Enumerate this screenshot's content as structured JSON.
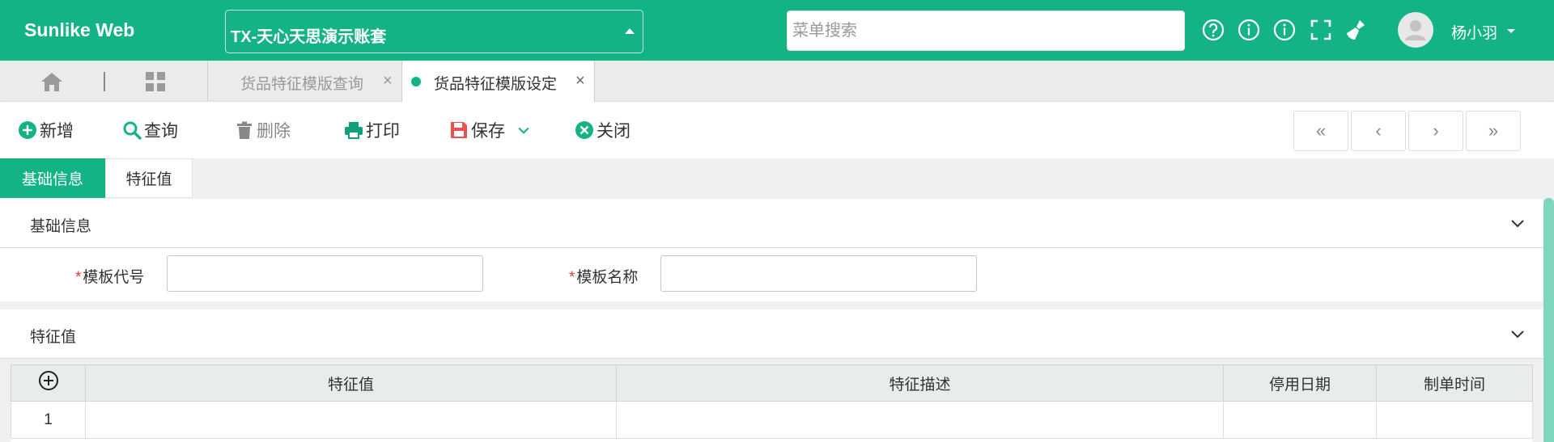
{
  "header": {
    "brand": "Sunlike Web",
    "account_name": "TX-天心天思演示账套",
    "menu_search_placeholder": "菜单搜索",
    "user_name": "杨小羽"
  },
  "tabs": [
    {
      "label": "货品特征模版查询",
      "active": false
    },
    {
      "label": "货品特征模版设定",
      "active": true
    }
  ],
  "toolbar": {
    "add": "新增",
    "query": "查询",
    "delete": "删除",
    "print": "打印",
    "save": "保存",
    "close": "关闭",
    "nav": [
      "«",
      "‹",
      "›",
      "»"
    ]
  },
  "subtabs": [
    "基础信息",
    "特征值"
  ],
  "basic_section": {
    "title": "基础信息",
    "fields": [
      {
        "label": "模板代号",
        "required": true,
        "value": ""
      },
      {
        "label": "模板名称",
        "required": true,
        "value": ""
      }
    ]
  },
  "feature_section": {
    "title": "特征值",
    "columns": [
      "特征值",
      "特征描述",
      "停用日期",
      "制单时间"
    ],
    "rows": [
      {
        "index": "1",
        "cells": [
          "",
          "",
          "",
          ""
        ]
      }
    ]
  },
  "colors": {
    "accent": "#14b386",
    "required": "#e03a3a",
    "print": "#0fa07a",
    "save": "#e8534f"
  }
}
